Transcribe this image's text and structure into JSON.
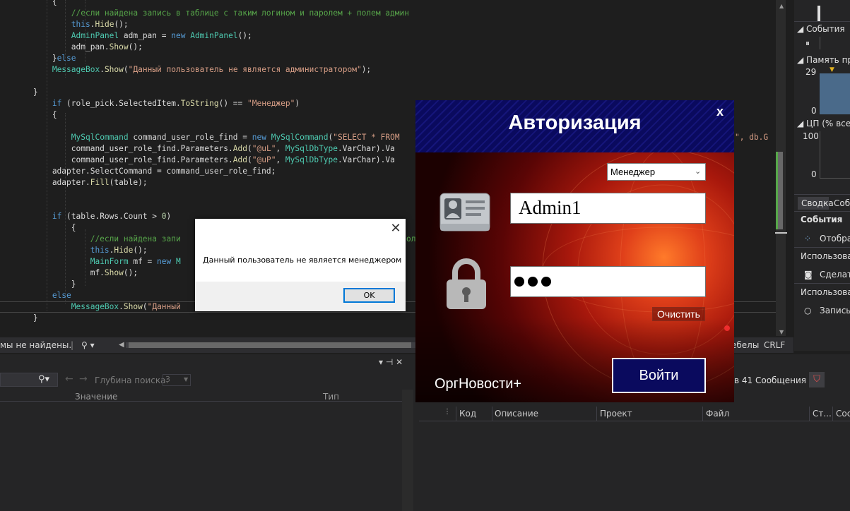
{
  "editor": {
    "lines": [
      [
        {
          "t": "            {",
          "c": ""
        }
      ],
      [
        {
          "t": "                //если найдена запись в таблице с таким логином и паролем + полем админ",
          "c": "cm"
        }
      ],
      [
        {
          "t": "                ",
          "c": ""
        },
        {
          "t": "this",
          "c": "kw"
        },
        {
          "t": ".",
          "c": ""
        },
        {
          "t": "Hide",
          "c": "mt"
        },
        {
          "t": "();",
          "c": ""
        }
      ],
      [
        {
          "t": "                ",
          "c": ""
        },
        {
          "t": "AdminPanel",
          "c": "ty"
        },
        {
          "t": " adm_pan = ",
          "c": ""
        },
        {
          "t": "new",
          "c": "kw"
        },
        {
          "t": " ",
          "c": ""
        },
        {
          "t": "AdminPanel",
          "c": "ty"
        },
        {
          "t": "();",
          "c": ""
        }
      ],
      [
        {
          "t": "                adm_pan.",
          "c": ""
        },
        {
          "t": "Show",
          "c": "mt"
        },
        {
          "t": "();",
          "c": ""
        }
      ],
      [
        {
          "t": "            }",
          "c": ""
        },
        {
          "t": "else",
          "c": "kw"
        }
      ],
      [
        {
          "t": "            ",
          "c": ""
        },
        {
          "t": "MessageBox",
          "c": "ty"
        },
        {
          "t": ".",
          "c": ""
        },
        {
          "t": "Show",
          "c": "mt"
        },
        {
          "t": "(",
          "c": ""
        },
        {
          "t": "\"Данный пользователь не является администратором\"",
          "c": "st"
        },
        {
          "t": ");",
          "c": ""
        }
      ],
      [
        {
          "t": "",
          "c": ""
        }
      ],
      [
        {
          "t": "        }",
          "c": ""
        }
      ],
      [
        {
          "t": "            ",
          "c": ""
        },
        {
          "t": "if",
          "c": "kw"
        },
        {
          "t": " (role_pick.SelectedItem.",
          "c": ""
        },
        {
          "t": "ToString",
          "c": "mt"
        },
        {
          "t": "() == ",
          "c": ""
        },
        {
          "t": "\"Менеджер\"",
          "c": "st"
        },
        {
          "t": ")",
          "c": ""
        }
      ],
      [
        {
          "t": "            {",
          "c": ""
        }
      ],
      [
        {
          "t": "",
          "c": ""
        }
      ],
      [
        {
          "t": "                ",
          "c": ""
        },
        {
          "t": "MySqlCommand",
          "c": "ty"
        },
        {
          "t": " command_user_role_find = ",
          "c": ""
        },
        {
          "t": "new",
          "c": "kw"
        },
        {
          "t": " ",
          "c": ""
        },
        {
          "t": "MySqlCommand",
          "c": "ty"
        },
        {
          "t": "(",
          "c": ""
        },
        {
          "t": "\"SELECT * FROM",
          "c": "st"
        }
      ],
      [
        {
          "t": "                command_user_role_find.Parameters.",
          "c": ""
        },
        {
          "t": "Add",
          "c": "mt"
        },
        {
          "t": "(",
          "c": ""
        },
        {
          "t": "\"@uL\"",
          "c": "st"
        },
        {
          "t": ", ",
          "c": ""
        },
        {
          "t": "MySqlDbType",
          "c": "ty"
        },
        {
          "t": ".VarChar).Va",
          "c": ""
        }
      ],
      [
        {
          "t": "                command_user_role_find.Parameters.",
          "c": ""
        },
        {
          "t": "Add",
          "c": "mt"
        },
        {
          "t": "(",
          "c": ""
        },
        {
          "t": "\"@uP\"",
          "c": "st"
        },
        {
          "t": ", ",
          "c": ""
        },
        {
          "t": "MySqlDbType",
          "c": "ty"
        },
        {
          "t": ".VarChar).Va",
          "c": ""
        }
      ],
      [
        {
          "t": "            adapter.SelectCommand = command_user_role_find;",
          "c": ""
        }
      ],
      [
        {
          "t": "            adapter.",
          "c": ""
        },
        {
          "t": "Fill",
          "c": "mt"
        },
        {
          "t": "(table);",
          "c": ""
        }
      ],
      [
        {
          "t": "",
          "c": ""
        }
      ],
      [
        {
          "t": "",
          "c": ""
        }
      ],
      [
        {
          "t": "            ",
          "c": ""
        },
        {
          "t": "if",
          "c": "kw"
        },
        {
          "t": " (table.Rows.Count > ",
          "c": ""
        },
        {
          "t": "0",
          "c": "nm"
        },
        {
          "t": ")",
          "c": ""
        }
      ],
      [
        {
          "t": "                {",
          "c": ""
        }
      ],
      [
        {
          "t": "                    //если найдена запи",
          "c": "cm"
        }
      ],
      [
        {
          "t": "                    ",
          "c": ""
        },
        {
          "t": "this",
          "c": "kw"
        },
        {
          "t": ".",
          "c": ""
        },
        {
          "t": "Hide",
          "c": "mt"
        },
        {
          "t": "();",
          "c": ""
        }
      ],
      [
        {
          "t": "                    ",
          "c": ""
        },
        {
          "t": "MainForm",
          "c": "ty"
        },
        {
          "t": " mf = ",
          "c": ""
        },
        {
          "t": "new",
          "c": "kw"
        },
        {
          "t": " M",
          "c": "ty"
        }
      ],
      [
        {
          "t": "                    mf.",
          "c": ""
        },
        {
          "t": "Show",
          "c": "mt"
        },
        {
          "t": "();",
          "c": ""
        }
      ],
      [
        {
          "t": "                }",
          "c": ""
        }
      ],
      [
        {
          "t": "            ",
          "c": ""
        },
        {
          "t": "else",
          "c": "kw"
        }
      ],
      [
        {
          "t": "                ",
          "c": ""
        },
        {
          "t": "MessageBox",
          "c": "ty"
        },
        {
          "t": ".",
          "c": ""
        },
        {
          "t": "Show",
          "c": "mt"
        },
        {
          "t": "(",
          "c": ""
        },
        {
          "t": "\"Данный",
          "c": "st"
        }
      ],
      [
        {
          "t": "        }",
          "c": ""
        }
      ]
    ],
    "tail_text": "\", db.G",
    "tail_text2": "оло"
  },
  "status_bar": {
    "issues": "мы не найдены.",
    "brush_icon": "brush-icon",
    "lines_label": "ебелы",
    "line_ending": "CRLF"
  },
  "left_panel": {
    "pin": "▾ ⊣ ✕",
    "search_icon": "search-icon",
    "depth_label": "Глубина поиска:",
    "depth_value": "3",
    "col_value": "Значение",
    "col_type": "Тип"
  },
  "right_panel": {
    "errors_label": "в 41 Сообщения",
    "columns": [
      "Код",
      "Описание",
      "Проект",
      "Файл",
      "Ст...",
      "Сос"
    ]
  },
  "diag": {
    "events_label": "События",
    "memory_label": "Память пре",
    "memory_max": "29",
    "memory_min": "0",
    "cpu_label": "ЦП (% всех",
    "cpu_max": "100",
    "cpu_min": "0",
    "tab_summary": "Сводка",
    "tab_events": "Соб",
    "section_events": "События",
    "show_label": "Отобра",
    "usage1": "Использова",
    "snapshot": "Сделать",
    "usage2": "Использова",
    "record": "Запись ("
  },
  "message_box": {
    "text": "Данный пользователь не является менеджером",
    "ok_label": "OK",
    "close_glyph": "✕"
  },
  "login": {
    "title": "Авторизация",
    "close_glyph": "x",
    "role_selected": "Менеджер",
    "login_value": "Admin1",
    "password_dots": 3,
    "clear_label": "Очистить",
    "login_button": "Войти",
    "brand": "ОргНовости+",
    "colors": {
      "header": "#0a0a5e",
      "accent": "#e0401a"
    }
  }
}
